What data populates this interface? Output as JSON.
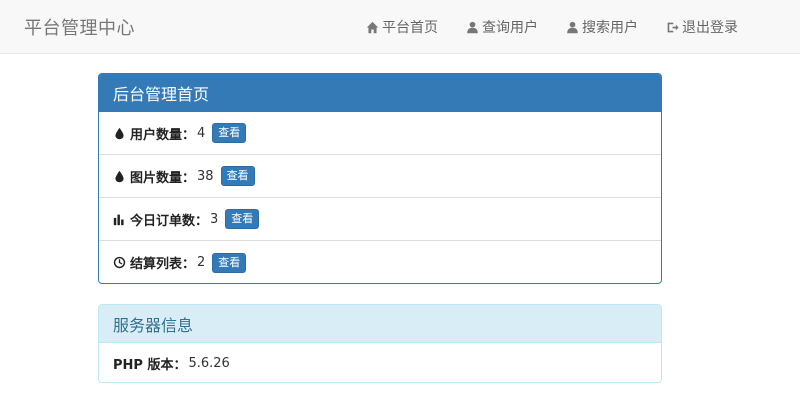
{
  "navbar": {
    "brand": "平台管理中心",
    "items": [
      {
        "label": "平台首页",
        "icon": "home-icon"
      },
      {
        "label": "查询用户",
        "icon": "user-icon"
      },
      {
        "label": "搜索用户",
        "icon": "user-icon"
      },
      {
        "label": "退出登录",
        "icon": "logout-icon"
      }
    ]
  },
  "dashboard": {
    "title": "后台管理首页",
    "rows": [
      {
        "icon": "tint-icon",
        "label": "用户数量：",
        "value": "4",
        "button": "查看"
      },
      {
        "icon": "tint-icon",
        "label": "图片数量：",
        "value": "38",
        "button": "查看"
      },
      {
        "icon": "stats-icon",
        "label": "今日订单数：",
        "value": "3",
        "button": "查看"
      },
      {
        "icon": "clock-icon",
        "label": "结算列表：",
        "value": "2",
        "button": "查看"
      }
    ]
  },
  "server": {
    "title": "服务器信息",
    "php_label": "PHP 版本：",
    "php_version": "5.6.26"
  },
  "colors": {
    "primary": "#337ab7",
    "info_bg": "#d9edf7",
    "info_text": "#31708f"
  }
}
